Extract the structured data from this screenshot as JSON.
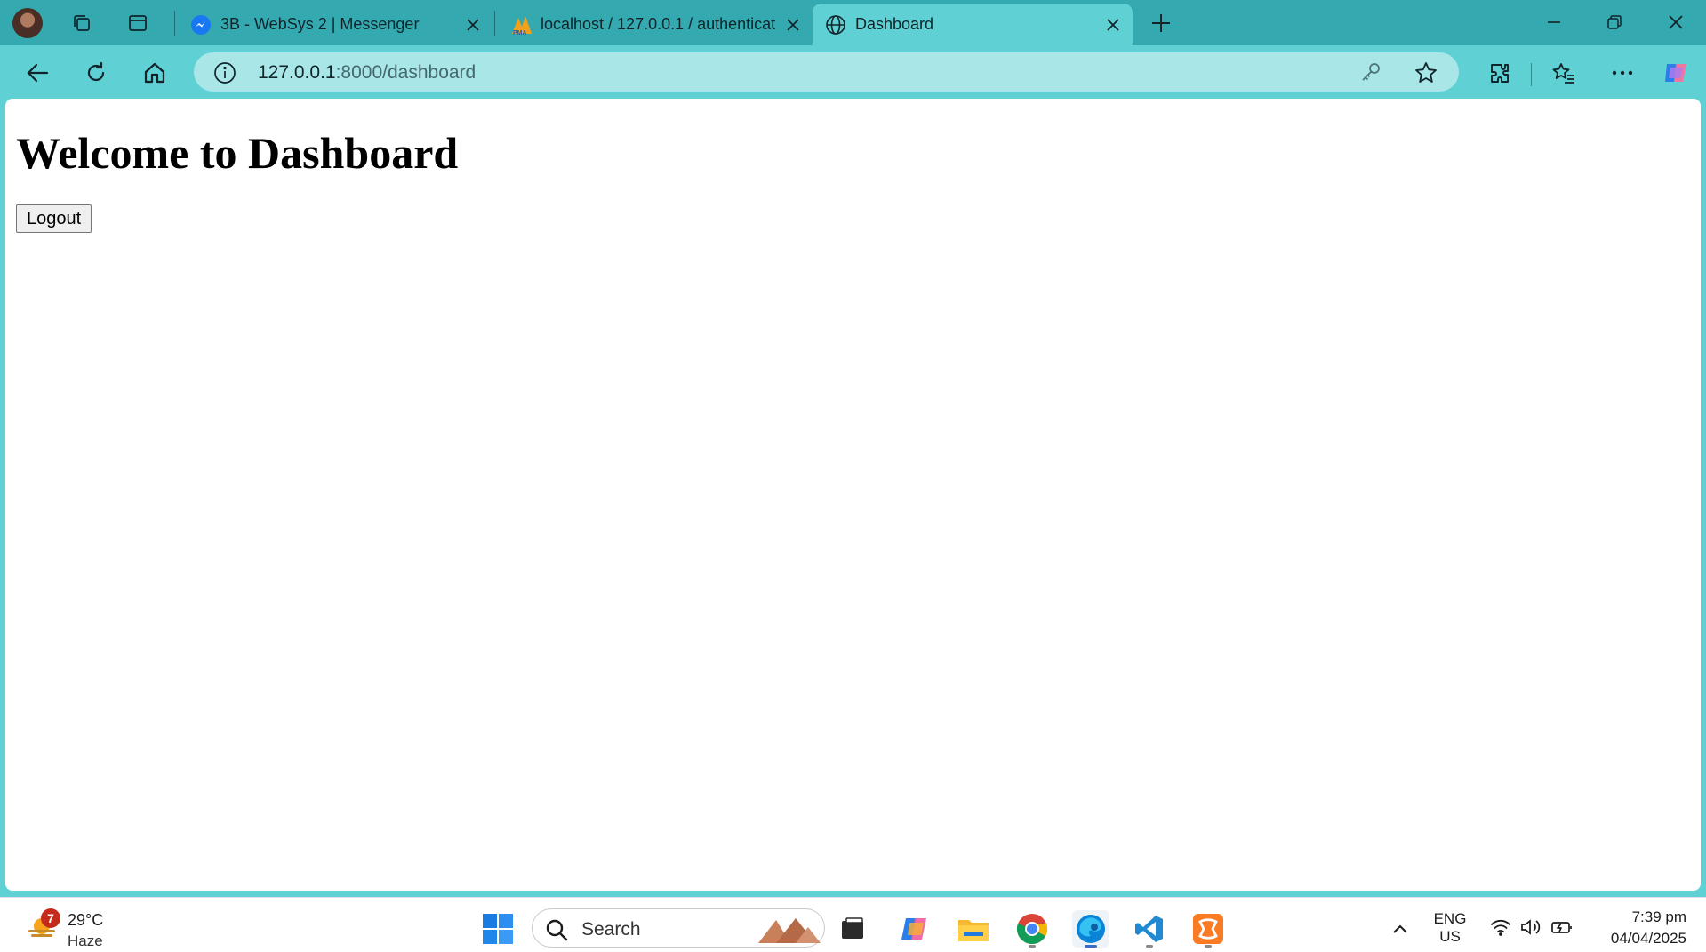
{
  "browser": {
    "tabs": [
      {
        "title": "3B - WebSys 2 | Messenger",
        "icon": "messenger-icon"
      },
      {
        "title": "localhost / 127.0.0.1 / authenticat",
        "icon": "phpmyadmin-icon"
      },
      {
        "title": "Dashboard",
        "icon": "globe-icon",
        "active": true
      }
    ],
    "address": {
      "host": "127.0.0.1",
      "path": ":8000/dashboard"
    }
  },
  "page": {
    "heading": "Welcome to Dashboard",
    "logout_label": "Logout"
  },
  "taskbar": {
    "weather": {
      "badge": "7",
      "temp": "29°C",
      "condition": "Haze"
    },
    "search_placeholder": "Search",
    "apps": [
      "windows-start-icon",
      "file-manager-icon",
      "copilot-icon",
      "file-explorer-icon",
      "chrome-icon",
      "edge-icon",
      "vscode-icon",
      "xampp-icon"
    ],
    "language": {
      "lang": "ENG",
      "region": "US"
    },
    "clock": {
      "time": "7:39 pm",
      "date": "04/04/2025"
    }
  },
  "colors": {
    "chrome": "#5fd0d3",
    "tabstrip": "#35a9b0",
    "omnibox": "#a9e6e8"
  }
}
